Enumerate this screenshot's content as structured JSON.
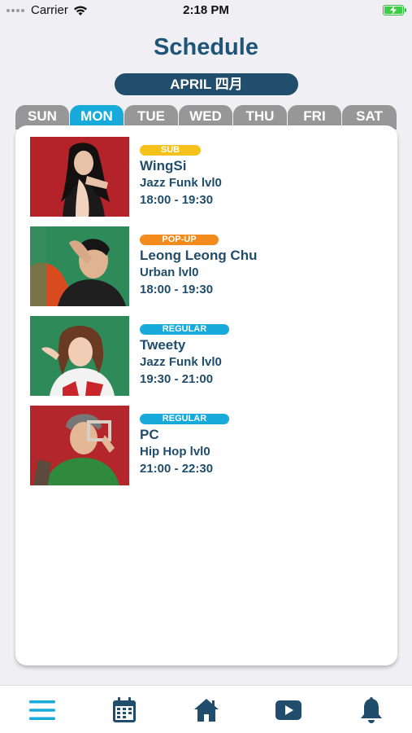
{
  "status_bar": {
    "carrier": "Carrier",
    "time": "2:18 PM"
  },
  "header": {
    "title": "Schedule",
    "month": "APRIL 四月"
  },
  "days": [
    "SUN",
    "MON",
    "TUE",
    "WED",
    "THU",
    "FRI",
    "SAT"
  ],
  "active_day": "MON",
  "colors": {
    "primary": "#1f4d6b",
    "accent": "#17aadb",
    "sub": "#f5c21b",
    "popup": "#f28a1c",
    "regular": "#17aadb",
    "tab_inactive": "#979797"
  },
  "classes": [
    {
      "badge": "SUB",
      "badge_color": "#f5c21b",
      "instructor": "WingSi",
      "style": "Jazz Funk lvl0",
      "time": "18:00 - 19:30"
    },
    {
      "badge": "POP-UP",
      "badge_color": "#f28a1c",
      "instructor": "Leong Leong Chu",
      "style": "Urban lvl0",
      "time": "18:00 - 19:30"
    },
    {
      "badge": "REGULAR",
      "badge_color": "#17aadb",
      "instructor": "Tweety",
      "style": "Jazz Funk lvl0",
      "time": "19:30 - 21:00"
    },
    {
      "badge": "REGULAR",
      "badge_color": "#17aadb",
      "instructor": "PC",
      "style": "Hip Hop lvl0",
      "time": "21:00 - 22:30"
    }
  ],
  "nav": [
    "menu-icon",
    "calendar-icon",
    "home-icon",
    "play-video-icon",
    "bell-icon"
  ]
}
